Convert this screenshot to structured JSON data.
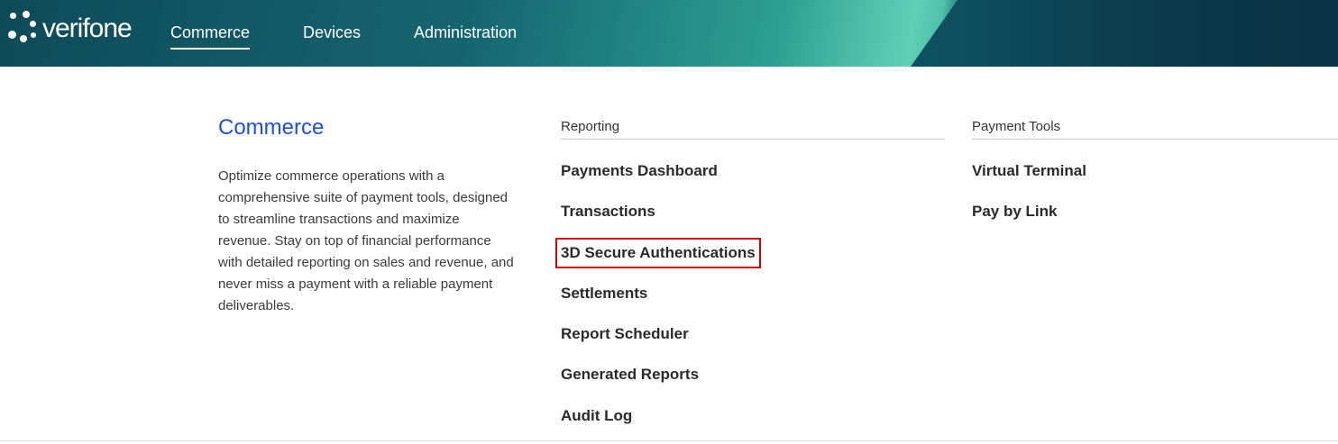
{
  "brand": {
    "name": "verifone"
  },
  "nav": {
    "items": [
      {
        "label": "Commerce",
        "active": true
      },
      {
        "label": "Devices",
        "active": false
      },
      {
        "label": "Administration",
        "active": false
      }
    ]
  },
  "intro": {
    "title": "Commerce",
    "description": "Optimize commerce operations with a comprehensive suite of payment tools, designed to streamline transactions and maximize revenue. Stay on top of financial performance with detailed reporting on sales and revenue, and never miss a payment with a reliable payment deliverables."
  },
  "reporting": {
    "heading": "Reporting",
    "links": [
      "Payments Dashboard",
      "Transactions",
      "3D Secure Authentications",
      "Settlements",
      "Report Scheduler",
      "Generated Reports",
      "Audit Log"
    ]
  },
  "payment_tools": {
    "heading": "Payment Tools",
    "links": [
      "Virtual Terminal",
      "Pay by Link"
    ]
  },
  "colors": {
    "accent_blue": "#1d4fdc",
    "highlight_red": "#d40000",
    "header_teal": "#15656f"
  }
}
